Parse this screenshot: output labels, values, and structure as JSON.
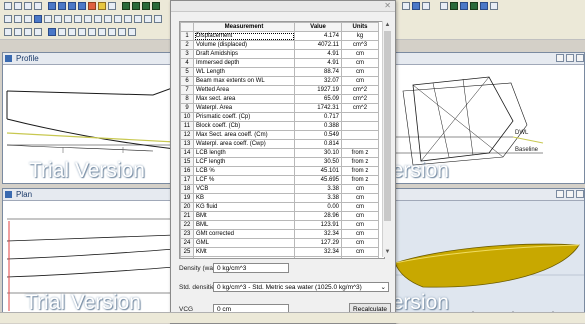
{
  "watermark": "Trial Version",
  "panels": {
    "profile": {
      "title": "Profile"
    },
    "plan": {
      "title": "Plan"
    }
  },
  "right_view": {
    "labels": {
      "dwl": "DWL",
      "baseline": "Baseline"
    }
  },
  "dialog": {
    "columns": {
      "num": "",
      "measurement": "Measurement",
      "value": "Value",
      "units": "Units"
    },
    "rows": [
      {
        "num": "1",
        "name": "Displacement",
        "value": "4.174",
        "unit": "kg"
      },
      {
        "num": "2",
        "name": "Volume (displaced)",
        "value": "4072.11",
        "unit": "cm^3"
      },
      {
        "num": "3",
        "name": "Draft Amidships",
        "value": "4.91",
        "unit": "cm"
      },
      {
        "num": "4",
        "name": "Immersed depth",
        "value": "4.91",
        "unit": "cm"
      },
      {
        "num": "5",
        "name": "WL Length",
        "value": "88.74",
        "unit": "cm"
      },
      {
        "num": "6",
        "name": "Beam max extents on WL",
        "value": "32.07",
        "unit": "cm"
      },
      {
        "num": "7",
        "name": "Wetted Area",
        "value": "1927.19",
        "unit": "cm^2"
      },
      {
        "num": "8",
        "name": "Max sect. area",
        "value": "65.09",
        "unit": "cm^2"
      },
      {
        "num": "9",
        "name": "Waterpl. Area",
        "value": "1742.31",
        "unit": "cm^2"
      },
      {
        "num": "10",
        "name": "Prismatic coeff. (Cp)",
        "value": "0.717",
        "unit": ""
      },
      {
        "num": "11",
        "name": "Block coeff. (Cb)",
        "value": "0.388",
        "unit": ""
      },
      {
        "num": "12",
        "name": "Max Sect. area coeff. (Cm)",
        "value": "0.549",
        "unit": ""
      },
      {
        "num": "13",
        "name": "Waterpl. area coeff. (Cwp)",
        "value": "0.814",
        "unit": ""
      },
      {
        "num": "14",
        "name": "LCB length",
        "value": "30.10",
        "unit": "from z"
      },
      {
        "num": "15",
        "name": "LCF length",
        "value": "30.50",
        "unit": "from z"
      },
      {
        "num": "16",
        "name": "LCB %",
        "value": "45.101",
        "unit": "from z"
      },
      {
        "num": "17",
        "name": "LCF %",
        "value": "45.695",
        "unit": "from z"
      },
      {
        "num": "18",
        "name": "VCB",
        "value": "3.38",
        "unit": "cm"
      },
      {
        "num": "19",
        "name": "KB",
        "value": "3.38",
        "unit": "cm"
      },
      {
        "num": "20",
        "name": "KG fluid",
        "value": "0.00",
        "unit": "cm"
      },
      {
        "num": "21",
        "name": "BMt",
        "value": "28.96",
        "unit": "cm"
      },
      {
        "num": "22",
        "name": "BML",
        "value": "123.91",
        "unit": "cm"
      },
      {
        "num": "23",
        "name": "GMt corrected",
        "value": "32.34",
        "unit": "cm"
      },
      {
        "num": "24",
        "name": "GML",
        "value": "127.29",
        "unit": "cm"
      },
      {
        "num": "25",
        "name": "KMt",
        "value": "32.34",
        "unit": "cm"
      },
      {
        "num": "26",
        "name": "KML",
        "value": "127.29",
        "unit": "cm"
      },
      {
        "num": "27",
        "name": "Immersion (TPc)",
        "value": "0.002",
        "unit": "tonne/c"
      },
      {
        "num": "28",
        "name": "MTc",
        "value": "0.000",
        "unit": "tonne"
      }
    ],
    "density_label": "Density (water)",
    "density_value": "0 kg/cm^3",
    "std_densities_label": "Std. densities",
    "std_densities_value": "0 kg/cm^3 - Std. Metric sea water (1025.0 kg/m^3)",
    "vcg_label": "VCG",
    "vcg_value": "0 cm",
    "recalculate_label": "Recalculate"
  }
}
